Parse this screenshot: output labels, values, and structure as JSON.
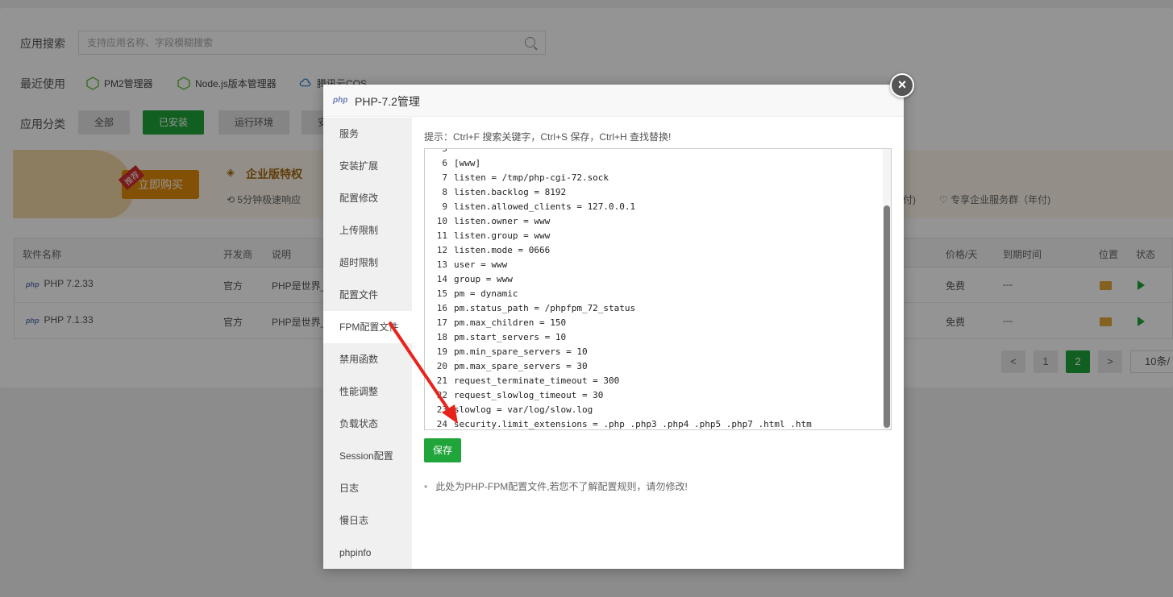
{
  "search": {
    "label": "应用搜索",
    "placeholder": "支持应用名称、字段模糊搜索"
  },
  "recent": {
    "label": "最近使用",
    "items": [
      "PM2管理器",
      "Node.js版本管理器",
      "腾讯云COS"
    ]
  },
  "category": {
    "label": "应用分类",
    "items": [
      "全部",
      "已安装",
      "运行环境",
      "安"
    ]
  },
  "banner": {
    "buy": "立即购买",
    "tag": "推荐",
    "title": "企业版特权",
    "feature_1": "5分钟极速响应",
    "feature_2": "付)",
    "feature_3": "专享企业服务群（年付)"
  },
  "table": {
    "headers": [
      "软件名称",
      "开发商",
      "说明",
      "价格/天",
      "到期时间",
      "位置",
      "状态"
    ],
    "rows": [
      {
        "name": "PHP 7.2.33",
        "vendor": "官方",
        "desc": "PHP是世界_",
        "price": "免费",
        "expire": "---"
      },
      {
        "name": "PHP 7.1.33",
        "vendor": "官方",
        "desc": "PHP是世界_",
        "price": "免费",
        "expire": "---"
      }
    ]
  },
  "pager": {
    "prev": "<",
    "p1": "1",
    "p2": "2",
    "next": ">",
    "size": "10条/"
  },
  "modal": {
    "logo": "php",
    "title": "PHP-7.2管理",
    "close": "×",
    "menu": [
      "服务",
      "安装扩展",
      "配置修改",
      "上传限制",
      "超时限制",
      "配置文件",
      "FPM配置文件",
      "禁用函数",
      "性能调整",
      "负载状态",
      "Session配置",
      "日志",
      "慢日志",
      "phpinfo"
    ],
    "active_menu": "FPM配置文件",
    "tip": "提示：Ctrl+F 搜索关键字，Ctrl+S 保存，Ctrl+H 查找替换!",
    "code": [
      {
        "n": "5",
        "t": ""
      },
      {
        "n": "6",
        "t": "[www]"
      },
      {
        "n": "7",
        "t": "listen = /tmp/php-cgi-72.sock"
      },
      {
        "n": "8",
        "t": "listen.backlog = 8192"
      },
      {
        "n": "9",
        "t": "listen.allowed_clients = 127.0.0.1"
      },
      {
        "n": "10",
        "t": "listen.owner = www"
      },
      {
        "n": "11",
        "t": "listen.group = www"
      },
      {
        "n": "12",
        "t": "listen.mode = 0666"
      },
      {
        "n": "13",
        "t": "user = www"
      },
      {
        "n": "14",
        "t": "group = www"
      },
      {
        "n": "15",
        "t": "pm = dynamic"
      },
      {
        "n": "16",
        "t": "pm.status_path = /phpfpm_72_status"
      },
      {
        "n": "17",
        "t": "pm.max_children = 150"
      },
      {
        "n": "18",
        "t": "pm.start_servers = 10"
      },
      {
        "n": "19",
        "t": "pm.min_spare_servers = 10"
      },
      {
        "n": "20",
        "t": "pm.max_spare_servers = 30"
      },
      {
        "n": "21",
        "t": "request_terminate_timeout = 300"
      },
      {
        "n": "22",
        "t": "request_slowlog_timeout = 30"
      },
      {
        "n": "23",
        "t": "slowlog = var/log/slow.log"
      },
      {
        "n": "24",
        "t": "security.limit_extensions = .php .php3 .php4 .php5 .php7 .html .htm"
      }
    ],
    "save": "保存",
    "notice": "此处为PHP-FPM配置文件,若您不了解配置规则，请勿修改!"
  },
  "colors": {
    "accent": "#20a53a",
    "arrow": "#e8231c"
  }
}
